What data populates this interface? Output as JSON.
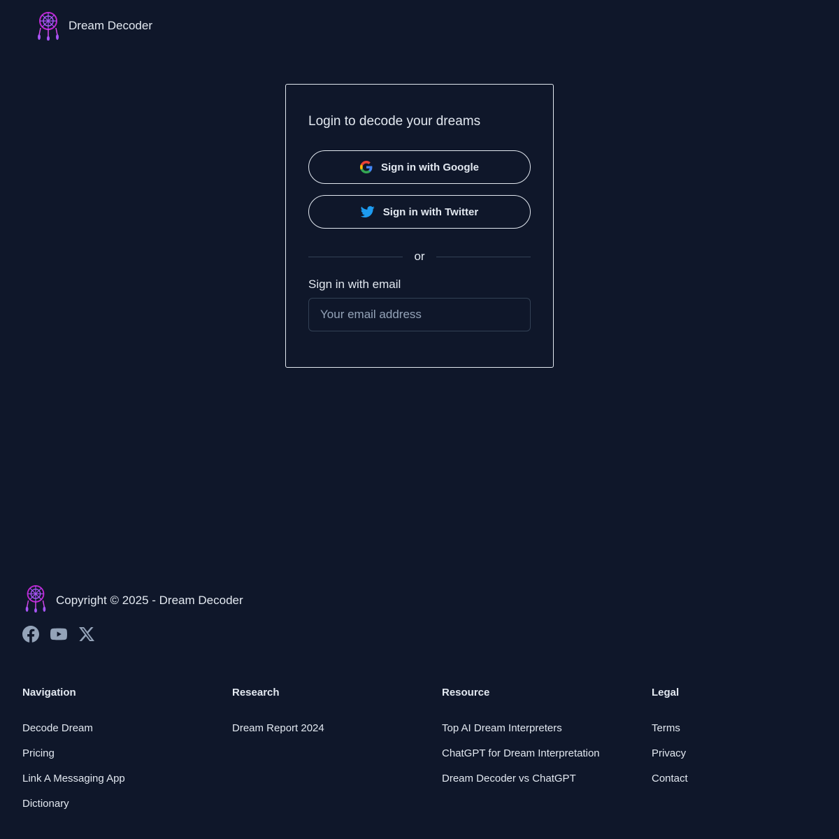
{
  "header": {
    "brand_name": "Dream Decoder",
    "logo_icon": "dreamcatcher-icon"
  },
  "login_card": {
    "title": "Login to decode your dreams",
    "google_button": "Sign in with Google",
    "twitter_button": "Sign in with Twitter",
    "divider_text": "or",
    "email_label": "Sign in with email",
    "email_placeholder": "Your email address",
    "email_value": ""
  },
  "footer": {
    "copyright": "Copyright © 2025 - Dream Decoder",
    "social": [
      "facebook-icon",
      "youtube-icon",
      "x-icon"
    ],
    "columns": [
      {
        "title": "Navigation",
        "links": [
          "Decode Dream",
          "Pricing",
          "Link A Messaging App",
          "Dictionary"
        ]
      },
      {
        "title": "Research",
        "links": [
          "Dream Report 2024"
        ]
      },
      {
        "title": "Resource",
        "links": [
          "Top AI Dream Interpreters",
          "ChatGPT for Dream Interpretation",
          "Dream Decoder vs ChatGPT"
        ]
      },
      {
        "title": "Legal",
        "links": [
          "Terms",
          "Privacy",
          "Contact"
        ]
      }
    ]
  },
  "colors": {
    "background": "#0f172a",
    "text": "#e2e8f0",
    "logo_purple": "#a855f7",
    "logo_pink": "#d946ef",
    "twitter_blue": "#1d9bf0"
  }
}
